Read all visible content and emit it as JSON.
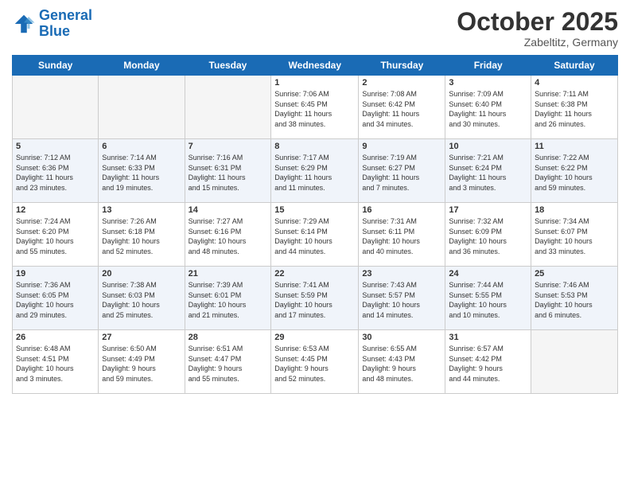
{
  "header": {
    "logo_general": "General",
    "logo_blue": "Blue",
    "month_title": "October 2025",
    "location": "Zabeltitz, Germany"
  },
  "days_of_week": [
    "Sunday",
    "Monday",
    "Tuesday",
    "Wednesday",
    "Thursday",
    "Friday",
    "Saturday"
  ],
  "weeks": [
    [
      {
        "day": "",
        "info": ""
      },
      {
        "day": "",
        "info": ""
      },
      {
        "day": "",
        "info": ""
      },
      {
        "day": "1",
        "info": "Sunrise: 7:06 AM\nSunset: 6:45 PM\nDaylight: 11 hours\nand 38 minutes."
      },
      {
        "day": "2",
        "info": "Sunrise: 7:08 AM\nSunset: 6:42 PM\nDaylight: 11 hours\nand 34 minutes."
      },
      {
        "day": "3",
        "info": "Sunrise: 7:09 AM\nSunset: 6:40 PM\nDaylight: 11 hours\nand 30 minutes."
      },
      {
        "day": "4",
        "info": "Sunrise: 7:11 AM\nSunset: 6:38 PM\nDaylight: 11 hours\nand 26 minutes."
      }
    ],
    [
      {
        "day": "5",
        "info": "Sunrise: 7:12 AM\nSunset: 6:36 PM\nDaylight: 11 hours\nand 23 minutes."
      },
      {
        "day": "6",
        "info": "Sunrise: 7:14 AM\nSunset: 6:33 PM\nDaylight: 11 hours\nand 19 minutes."
      },
      {
        "day": "7",
        "info": "Sunrise: 7:16 AM\nSunset: 6:31 PM\nDaylight: 11 hours\nand 15 minutes."
      },
      {
        "day": "8",
        "info": "Sunrise: 7:17 AM\nSunset: 6:29 PM\nDaylight: 11 hours\nand 11 minutes."
      },
      {
        "day": "9",
        "info": "Sunrise: 7:19 AM\nSunset: 6:27 PM\nDaylight: 11 hours\nand 7 minutes."
      },
      {
        "day": "10",
        "info": "Sunrise: 7:21 AM\nSunset: 6:24 PM\nDaylight: 11 hours\nand 3 minutes."
      },
      {
        "day": "11",
        "info": "Sunrise: 7:22 AM\nSunset: 6:22 PM\nDaylight: 10 hours\nand 59 minutes."
      }
    ],
    [
      {
        "day": "12",
        "info": "Sunrise: 7:24 AM\nSunset: 6:20 PM\nDaylight: 10 hours\nand 55 minutes."
      },
      {
        "day": "13",
        "info": "Sunrise: 7:26 AM\nSunset: 6:18 PM\nDaylight: 10 hours\nand 52 minutes."
      },
      {
        "day": "14",
        "info": "Sunrise: 7:27 AM\nSunset: 6:16 PM\nDaylight: 10 hours\nand 48 minutes."
      },
      {
        "day": "15",
        "info": "Sunrise: 7:29 AM\nSunset: 6:14 PM\nDaylight: 10 hours\nand 44 minutes."
      },
      {
        "day": "16",
        "info": "Sunrise: 7:31 AM\nSunset: 6:11 PM\nDaylight: 10 hours\nand 40 minutes."
      },
      {
        "day": "17",
        "info": "Sunrise: 7:32 AM\nSunset: 6:09 PM\nDaylight: 10 hours\nand 36 minutes."
      },
      {
        "day": "18",
        "info": "Sunrise: 7:34 AM\nSunset: 6:07 PM\nDaylight: 10 hours\nand 33 minutes."
      }
    ],
    [
      {
        "day": "19",
        "info": "Sunrise: 7:36 AM\nSunset: 6:05 PM\nDaylight: 10 hours\nand 29 minutes."
      },
      {
        "day": "20",
        "info": "Sunrise: 7:38 AM\nSunset: 6:03 PM\nDaylight: 10 hours\nand 25 minutes."
      },
      {
        "day": "21",
        "info": "Sunrise: 7:39 AM\nSunset: 6:01 PM\nDaylight: 10 hours\nand 21 minutes."
      },
      {
        "day": "22",
        "info": "Sunrise: 7:41 AM\nSunset: 5:59 PM\nDaylight: 10 hours\nand 17 minutes."
      },
      {
        "day": "23",
        "info": "Sunrise: 7:43 AM\nSunset: 5:57 PM\nDaylight: 10 hours\nand 14 minutes."
      },
      {
        "day": "24",
        "info": "Sunrise: 7:44 AM\nSunset: 5:55 PM\nDaylight: 10 hours\nand 10 minutes."
      },
      {
        "day": "25",
        "info": "Sunrise: 7:46 AM\nSunset: 5:53 PM\nDaylight: 10 hours\nand 6 minutes."
      }
    ],
    [
      {
        "day": "26",
        "info": "Sunrise: 6:48 AM\nSunset: 4:51 PM\nDaylight: 10 hours\nand 3 minutes."
      },
      {
        "day": "27",
        "info": "Sunrise: 6:50 AM\nSunset: 4:49 PM\nDaylight: 9 hours\nand 59 minutes."
      },
      {
        "day": "28",
        "info": "Sunrise: 6:51 AM\nSunset: 4:47 PM\nDaylight: 9 hours\nand 55 minutes."
      },
      {
        "day": "29",
        "info": "Sunrise: 6:53 AM\nSunset: 4:45 PM\nDaylight: 9 hours\nand 52 minutes."
      },
      {
        "day": "30",
        "info": "Sunrise: 6:55 AM\nSunset: 4:43 PM\nDaylight: 9 hours\nand 48 minutes."
      },
      {
        "day": "31",
        "info": "Sunrise: 6:57 AM\nSunset: 4:42 PM\nDaylight: 9 hours\nand 44 minutes."
      },
      {
        "day": "",
        "info": ""
      }
    ]
  ]
}
